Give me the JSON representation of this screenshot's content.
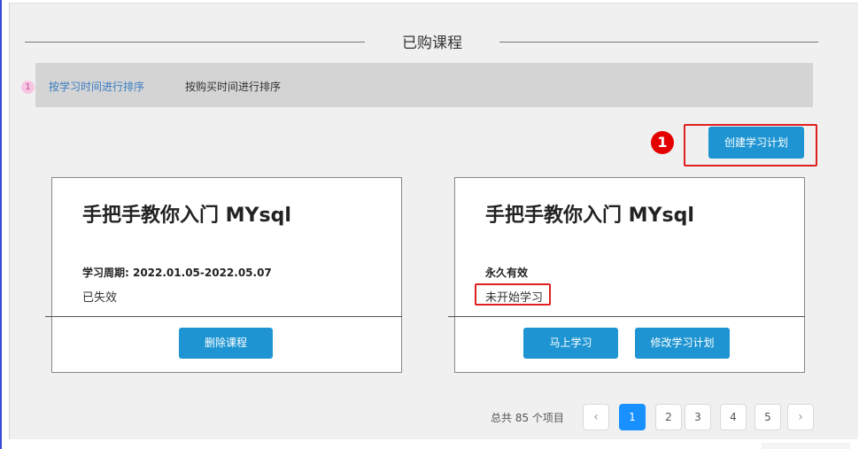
{
  "section_title": "已购课程",
  "sort": {
    "index": "1",
    "tabs": [
      {
        "label": "按学习时间进行排序",
        "active": true
      },
      {
        "label": "按购买时间进行排序",
        "active": false
      }
    ]
  },
  "annotation_badge": "1",
  "create_plan_label": "创建学习计划",
  "courses": [
    {
      "title": "手把手教你入门 MYsql",
      "period": "学习周期: 2022.01.05-2022.05.07",
      "status": "已失效",
      "buttons": [
        "删除课程"
      ]
    },
    {
      "title": "手把手教你入门 MYsql",
      "period": "永久有效",
      "status": "未开始学习",
      "buttons": [
        "马上学习",
        "修改学习计划"
      ]
    }
  ],
  "pagination": {
    "total_text": "总共 85 个项目",
    "prev_icon": "‹",
    "next_icon": "›",
    "pages": [
      "1",
      "2",
      "3",
      "4",
      "5"
    ],
    "current": "1"
  },
  "colors": {
    "primary_button": "#1e95d2",
    "active_page": "#1890ff",
    "highlight_outline": "#e02020",
    "badge": "#e50000"
  }
}
